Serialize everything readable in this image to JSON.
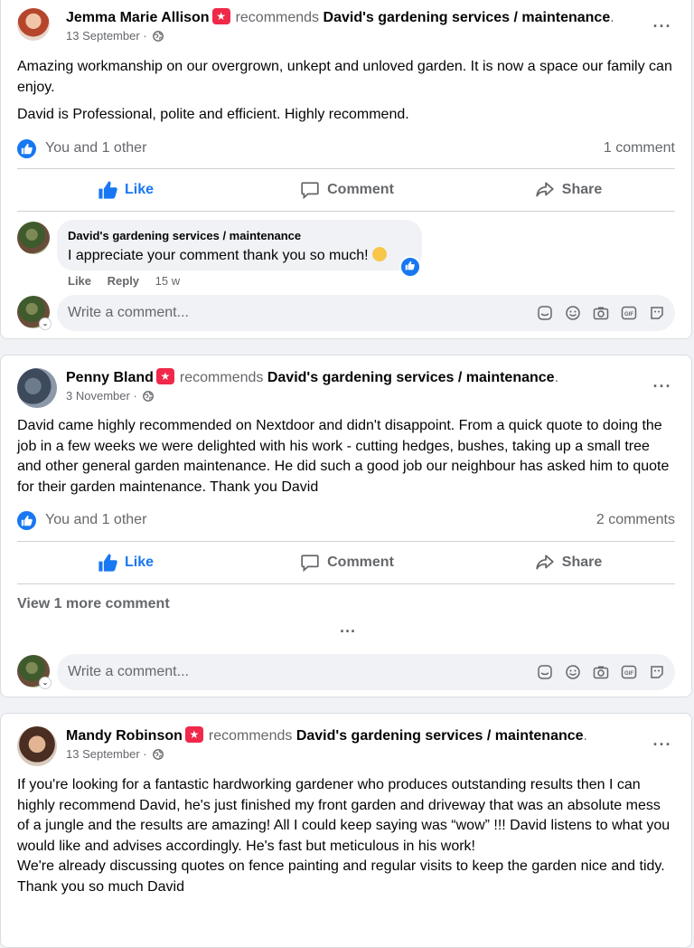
{
  "posts": [
    {
      "author": "Jemma Marie Allison",
      "recommends_text": "recommends",
      "page": "David's gardening services / maintenance",
      "date": "13 September ·",
      "paragraphs": [
        "Amazing workmanship on our overgrown, unkept and unloved garden. It is now a space our family can enjoy.",
        "David is Professional, polite and efficient. Highly recommend."
      ],
      "reactions_text": "You and 1 other",
      "comments_count": "1 comment",
      "actions": {
        "like": "Like",
        "comment": "Comment",
        "share": "Share"
      },
      "reply": {
        "name": "David's gardening services / maintenance",
        "text": "I appreciate your comment thank you so much!",
        "like": "Like",
        "reply": "Reply",
        "time": "15 w"
      },
      "write_placeholder": "Write a comment..."
    },
    {
      "author": "Penny Bland",
      "recommends_text": "recommends",
      "page": "David's gardening services / maintenance",
      "date": "3 November ·",
      "paragraphs": [
        "David came highly recommended on Nextdoor and didn't disappoint.  From a quick quote to doing the job  in a few weeks we were delighted with his work - cutting hedges, bushes, taking up a small tree and other general garden maintenance.  He did such a good job our neighbour has asked him to quote for their garden maintenance.  Thank you David"
      ],
      "reactions_text": "You and 1 other",
      "comments_count": "2 comments",
      "actions": {
        "like": "Like",
        "comment": "Comment",
        "share": "Share"
      },
      "view_more": "View 1 more comment",
      "write_placeholder": "Write a comment..."
    },
    {
      "author": "Mandy Robinson",
      "recommends_text": "recommends",
      "page": "David's gardening services / maintenance",
      "date": "13 September ·",
      "paragraphs": [
        "If you're looking for a fantastic hardworking gardener who produces outstanding results then I can highly recommend David, he's just finished my front garden and driveway that was an absolute mess of a jungle and the results are amazing!  All I could keep saying was “wow” !!! David listens to what you would like and advises accordingly.  He's fast but meticulous in his work!",
        "We're already discussing quotes on fence painting and regular visits to keep the garden nice and tidy.",
        "Thank you so much David"
      ]
    }
  ],
  "colors": {
    "accent": "#1877f2",
    "badge": "#f02849",
    "muted": "#65676b"
  },
  "icons": [
    "globe-icon",
    "more-options-icon",
    "like-icon",
    "comment-icon",
    "share-icon",
    "sticker-icon",
    "emoji-icon",
    "camera-icon",
    "gif-icon",
    "avatar-sticker-icon"
  ]
}
